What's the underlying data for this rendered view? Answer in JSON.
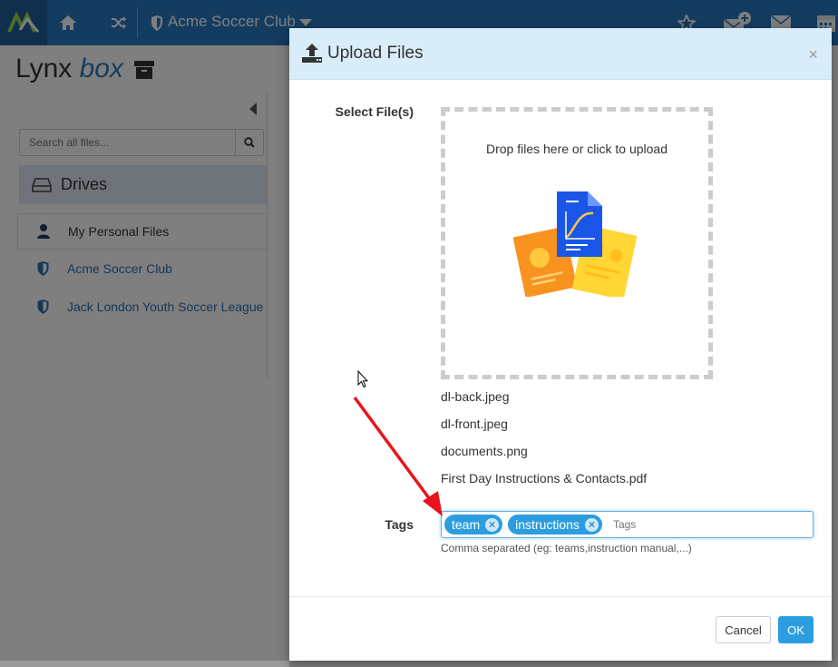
{
  "topbar": {
    "club_name": "Acme Soccer Club",
    "icons": [
      "logo-icon",
      "home-icon",
      "shuffle-icon",
      "shield-icon",
      "caret-down-icon",
      "star-icon",
      "mail-add-icon",
      "mail-icon",
      "calendar-icon"
    ]
  },
  "app": {
    "title_part1": "Lynx",
    "title_part2": "box"
  },
  "sidebar": {
    "search_placeholder": "Search all files...",
    "drives_label": "Drives",
    "items": [
      {
        "label": "My Personal Files",
        "icon": "user-icon",
        "active": true
      },
      {
        "label": "Acme Soccer Club",
        "icon": "shield-icon",
        "active": false
      },
      {
        "label": "Jack London Youth Soccer League",
        "icon": "shield-icon",
        "active": false
      }
    ]
  },
  "modal": {
    "title": "Upload Files",
    "close_label": "×",
    "select_label": "Select File(s)",
    "drop_text": "Drop files here or click to upload",
    "files": [
      "dl-back.jpeg",
      "dl-front.jpeg",
      "documents.png",
      "First Day Instructions & Contacts.pdf"
    ],
    "tags_label": "Tags",
    "tags": [
      "team",
      "instructions"
    ],
    "tag_remove_glyph": "✕",
    "tags_placeholder": "Tags",
    "tags_help": "Comma separated (eg: teams,instruction manual,...)",
    "cancel_label": "Cancel",
    "ok_label": "OK"
  },
  "colors": {
    "topbar": "#2979c2",
    "accent": "#2c9ee0",
    "modal_header": "#d8ecf9",
    "annotation_arrow": "#e8141b"
  }
}
